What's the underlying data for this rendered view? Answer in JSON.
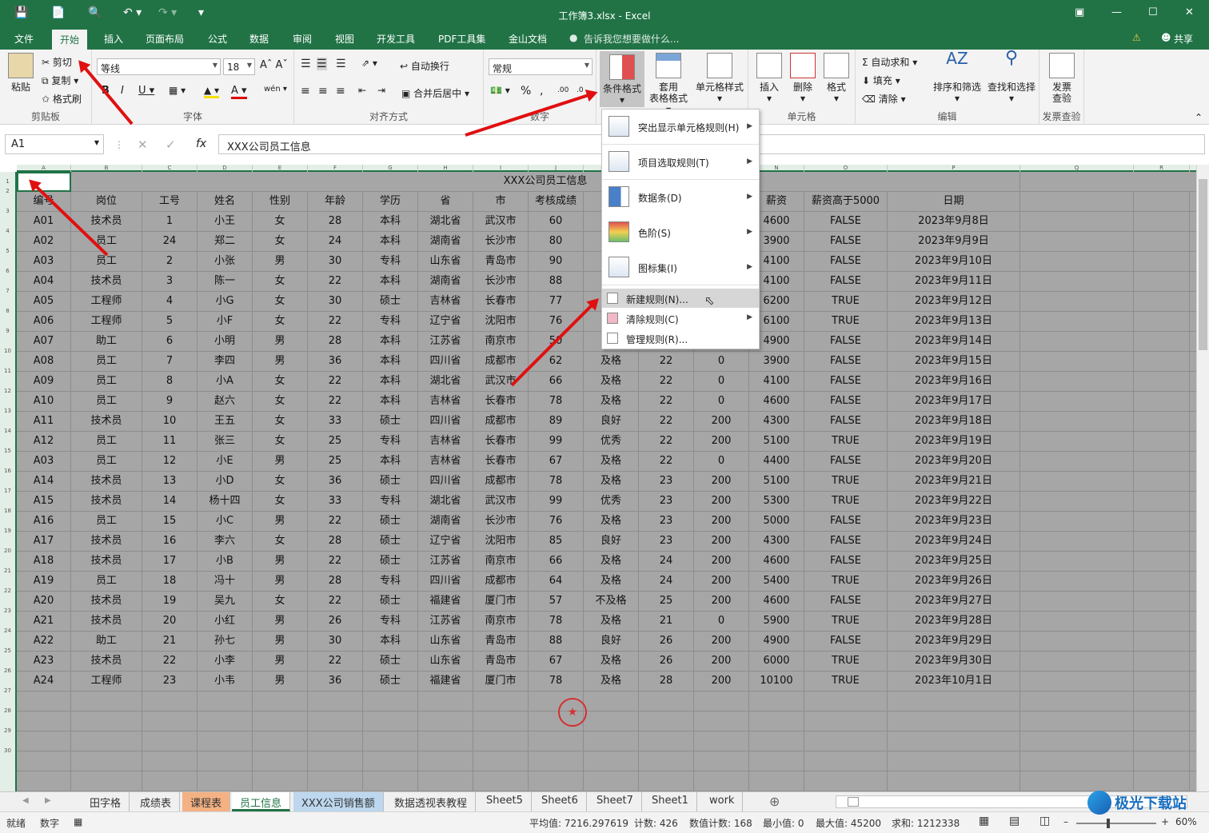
{
  "window": {
    "title": "工作簿3.xlsx - Excel",
    "share": "共享"
  },
  "menu": {
    "file": "文件",
    "home": "开始",
    "insert": "插入",
    "layout": "页面布局",
    "formula": "公式",
    "data": "数据",
    "review": "审阅",
    "view": "视图",
    "dev": "开发工具",
    "pdf": "PDF工具集",
    "jinshan": "金山文档",
    "tell": "告诉我您想要做什么..."
  },
  "ribbon": {
    "clipboard": {
      "paste": "粘贴",
      "cut": "剪切",
      "copy": "复制",
      "painter": "格式刷",
      "label": "剪贴板"
    },
    "font": {
      "name": "等线",
      "size": "18",
      "label": "字体"
    },
    "align": {
      "wrap": "自动换行",
      "merge": "合并后居中",
      "label": "对齐方式"
    },
    "number": {
      "format": "常规",
      "label": "数字"
    },
    "styles": {
      "cond": "条件格式",
      "table1": "套用",
      "table2": "表格格式",
      "cell": "单元格样式"
    },
    "cells": {
      "insert": "插入",
      "delete": "删除",
      "format": "格式",
      "label": "单元格"
    },
    "edit": {
      "autosum": "自动求和",
      "fill": "填充",
      "clear": "清除",
      "sort": "排序和筛选",
      "find": "查找和选择",
      "label": "编辑"
    },
    "invoice": {
      "l1": "发票",
      "l2": "查验",
      "label": "发票查验"
    }
  },
  "formula": {
    "namebox": "A1",
    "content": "XXX公司员工信息"
  },
  "columns": [
    "A",
    "B",
    "C",
    "D",
    "E",
    "F",
    "G",
    "H",
    "I",
    "J",
    "K",
    "L",
    "M",
    "N",
    "O",
    "P",
    "Q",
    "R"
  ],
  "rownums": [
    "1",
    "2",
    "3",
    "4",
    "5",
    "6",
    "7",
    "8",
    "9",
    "10",
    "11",
    "12",
    "13",
    "14",
    "15",
    "16",
    "17",
    "18",
    "19",
    "20",
    "21",
    "22",
    "23",
    "24",
    "25",
    "26",
    "27",
    "28",
    "29",
    "30"
  ],
  "sheet_title": "XXX公司员工信息",
  "headers": [
    "编号",
    "岗位",
    "工号",
    "姓名",
    "性别",
    "年龄",
    "学历",
    "省",
    "市",
    "考核成绩",
    "",
    "",
    "",
    "薪资",
    "薪资高于5000",
    "日期"
  ],
  "rows": [
    [
      "A01",
      "技术员",
      "1",
      "小王",
      "女",
      "28",
      "本科",
      "湖北省",
      "武汉市",
      "60",
      "",
      "",
      "",
      "4600",
      "FALSE",
      "2023年9月8日"
    ],
    [
      "A02",
      "员工",
      "24",
      "郑二",
      "女",
      "24",
      "本科",
      "湖南省",
      "长沙市",
      "80",
      "",
      "",
      "",
      "3900",
      "FALSE",
      "2023年9月9日"
    ],
    [
      "A03",
      "员工",
      "2",
      "小张",
      "男",
      "30",
      "专科",
      "山东省",
      "青岛市",
      "90",
      "",
      "",
      "",
      "4100",
      "FALSE",
      "2023年9月10日"
    ],
    [
      "A04",
      "技术员",
      "3",
      "陈一",
      "女",
      "22",
      "本科",
      "湖南省",
      "长沙市",
      "88",
      "",
      "",
      "",
      "4100",
      "FALSE",
      "2023年9月11日"
    ],
    [
      "A05",
      "工程师",
      "4",
      "小G",
      "女",
      "30",
      "硕士",
      "吉林省",
      "长春市",
      "77",
      "",
      "",
      "",
      "6200",
      "TRUE",
      "2023年9月12日"
    ],
    [
      "A06",
      "工程师",
      "5",
      "小F",
      "女",
      "22",
      "专科",
      "辽宁省",
      "沈阳市",
      "76",
      "",
      "",
      "",
      "6100",
      "TRUE",
      "2023年9月13日"
    ],
    [
      "A07",
      "助工",
      "6",
      "小明",
      "男",
      "28",
      "本科",
      "江苏省",
      "南京市",
      "50",
      "",
      "",
      "",
      "4900",
      "FALSE",
      "2023年9月14日"
    ],
    [
      "A08",
      "员工",
      "7",
      "李四",
      "男",
      "36",
      "本科",
      "四川省",
      "成都市",
      "62",
      "及格",
      "22",
      "0",
      "3900",
      "FALSE",
      "2023年9月15日"
    ],
    [
      "A09",
      "员工",
      "8",
      "小A",
      "女",
      "22",
      "本科",
      "湖北省",
      "武汉市",
      "66",
      "及格",
      "22",
      "0",
      "4100",
      "FALSE",
      "2023年9月16日"
    ],
    [
      "A10",
      "员工",
      "9",
      "赵六",
      "女",
      "22",
      "本科",
      "吉林省",
      "长春市",
      "78",
      "及格",
      "22",
      "0",
      "4600",
      "FALSE",
      "2023年9月17日"
    ],
    [
      "A11",
      "技术员",
      "10",
      "王五",
      "女",
      "33",
      "硕士",
      "四川省",
      "成都市",
      "89",
      "良好",
      "22",
      "200",
      "4300",
      "FALSE",
      "2023年9月18日"
    ],
    [
      "A12",
      "员工",
      "11",
      "张三",
      "女",
      "25",
      "专科",
      "吉林省",
      "长春市",
      "99",
      "优秀",
      "22",
      "200",
      "5100",
      "TRUE",
      "2023年9月19日"
    ],
    [
      "A03",
      "员工",
      "12",
      "小E",
      "男",
      "25",
      "本科",
      "吉林省",
      "长春市",
      "67",
      "及格",
      "22",
      "0",
      "4400",
      "FALSE",
      "2023年9月20日"
    ],
    [
      "A14",
      "技术员",
      "13",
      "小D",
      "女",
      "36",
      "硕士",
      "四川省",
      "成都市",
      "78",
      "及格",
      "23",
      "200",
      "5100",
      "TRUE",
      "2023年9月21日"
    ],
    [
      "A15",
      "技术员",
      "14",
      "杨十四",
      "女",
      "33",
      "专科",
      "湖北省",
      "武汉市",
      "99",
      "优秀",
      "23",
      "200",
      "5300",
      "TRUE",
      "2023年9月22日"
    ],
    [
      "A16",
      "员工",
      "15",
      "小C",
      "男",
      "22",
      "硕士",
      "湖南省",
      "长沙市",
      "76",
      "及格",
      "23",
      "200",
      "5000",
      "FALSE",
      "2023年9月23日"
    ],
    [
      "A17",
      "技术员",
      "16",
      "李六",
      "女",
      "28",
      "硕士",
      "辽宁省",
      "沈阳市",
      "85",
      "良好",
      "23",
      "200",
      "4300",
      "FALSE",
      "2023年9月24日"
    ],
    [
      "A18",
      "技术员",
      "17",
      "小B",
      "男",
      "22",
      "硕士",
      "江苏省",
      "南京市",
      "66",
      "及格",
      "24",
      "200",
      "4600",
      "FALSE",
      "2023年9月25日"
    ],
    [
      "A19",
      "员工",
      "18",
      "冯十",
      "男",
      "28",
      "专科",
      "四川省",
      "成都市",
      "64",
      "及格",
      "24",
      "200",
      "5400",
      "TRUE",
      "2023年9月26日"
    ],
    [
      "A20",
      "技术员",
      "19",
      "吴九",
      "女",
      "22",
      "硕士",
      "福建省",
      "厦门市",
      "57",
      "不及格",
      "25",
      "200",
      "4600",
      "FALSE",
      "2023年9月27日"
    ],
    [
      "A21",
      "技术员",
      "20",
      "小红",
      "男",
      "26",
      "专科",
      "江苏省",
      "南京市",
      "78",
      "及格",
      "21",
      "0",
      "5900",
      "TRUE",
      "2023年9月28日"
    ],
    [
      "A22",
      "助工",
      "21",
      "孙七",
      "男",
      "30",
      "本科",
      "山东省",
      "青岛市",
      "88",
      "良好",
      "26",
      "200",
      "4900",
      "FALSE",
      "2023年9月29日"
    ],
    [
      "A23",
      "技术员",
      "22",
      "小李",
      "男",
      "22",
      "硕士",
      "山东省",
      "青岛市",
      "67",
      "及格",
      "26",
      "200",
      "6000",
      "TRUE",
      "2023年9月30日"
    ],
    [
      "A24",
      "工程师",
      "23",
      "小韦",
      "男",
      "36",
      "硕士",
      "福建省",
      "厦门市",
      "78",
      "及格",
      "28",
      "200",
      "10100",
      "TRUE",
      "2023年10月1日"
    ]
  ],
  "dropdown": {
    "highlight": "突出显示单元格规则(H)",
    "topbottom": "项目选取规则(T)",
    "databar": "数据条(D)",
    "colorscale": "色阶(S)",
    "iconset": "图标集(I)",
    "newrule": "新建规则(N)...",
    "clearrule": "清除规则(C)",
    "managerule": "管理规则(R)..."
  },
  "tabs": [
    "田字格",
    "成绩表",
    "课程表",
    "员工信息",
    "XXX公司销售额",
    "数据透视表教程",
    "Sheet5",
    "Sheet6",
    "Sheet7",
    "Sheet1",
    "work"
  ],
  "status": {
    "ready": "就绪",
    "num": "数字",
    "avg": "平均值: 7216.297619",
    "count": "计数: 426",
    "numcount": "数值计数: 168",
    "min": "最小值: 0",
    "max": "最大值: 45200",
    "sum": "求和: 1212338",
    "zoom": "60%"
  },
  "watermark": "极光下载站",
  "colors": {
    "excel_green": "#217346",
    "arrow_red": "#e01010"
  }
}
